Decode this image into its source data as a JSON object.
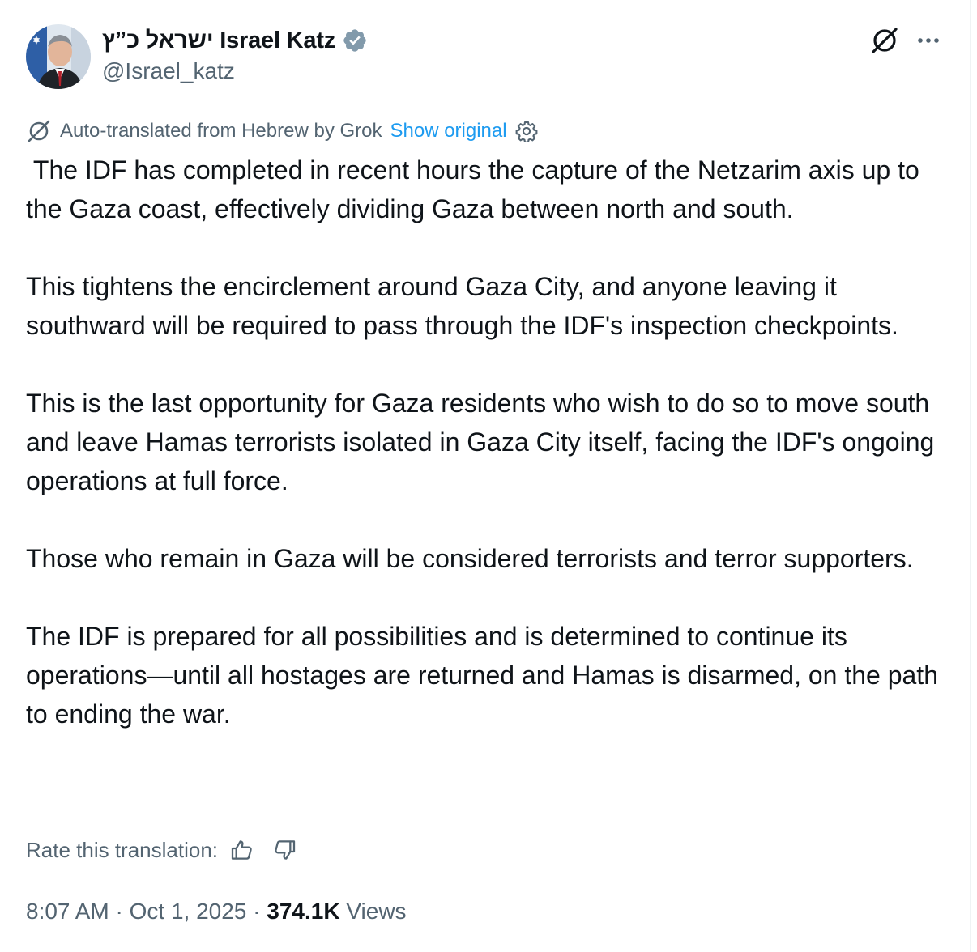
{
  "author": {
    "display_name": "ישראל כ”ץ Israel Katz",
    "handle": "@Israel_katz",
    "verified_badge_color": "#829aab"
  },
  "icons": {
    "grok_top": "grok-icon",
    "more": "more-options-icon",
    "grok_small": "grok-icon",
    "settings": "gear-icon",
    "thumbs_up": "thumbs-up-icon",
    "thumbs_down": "thumbs-down-icon"
  },
  "translation": {
    "label": "Auto-translated from Hebrew by Grok",
    "show_original": "Show original"
  },
  "tweet": {
    "paragraphs": [
      " The IDF has completed in recent hours the capture of the Netzarim axis up to the Gaza coast, effectively dividing Gaza between north and south.",
      "This tightens the encirclement around Gaza City, and anyone leaving it southward will be required to pass through the IDF's inspection checkpoints.",
      "This is the last opportunity for Gaza residents who wish to do so to move south and leave Hamas terrorists isolated in Gaza City itself, facing the IDF's ongoing operations at full force.",
      "Those who remain in Gaza will be considered terrorists and terror supporters.",
      "The IDF is prepared for all possibilities and is determined to continue its operations—until all hostages are returned and Hamas is disarmed, on the path to ending the war."
    ]
  },
  "rating": {
    "label": "Rate this translation:"
  },
  "meta": {
    "time": "8:07 AM",
    "separator": " · ",
    "date": "Oct 1, 2025",
    "views_count": "374.1K",
    "views_label": " Views"
  },
  "colors": {
    "text_primary": "#0f1419",
    "text_secondary": "#536471",
    "link": "#1d9bf0"
  }
}
